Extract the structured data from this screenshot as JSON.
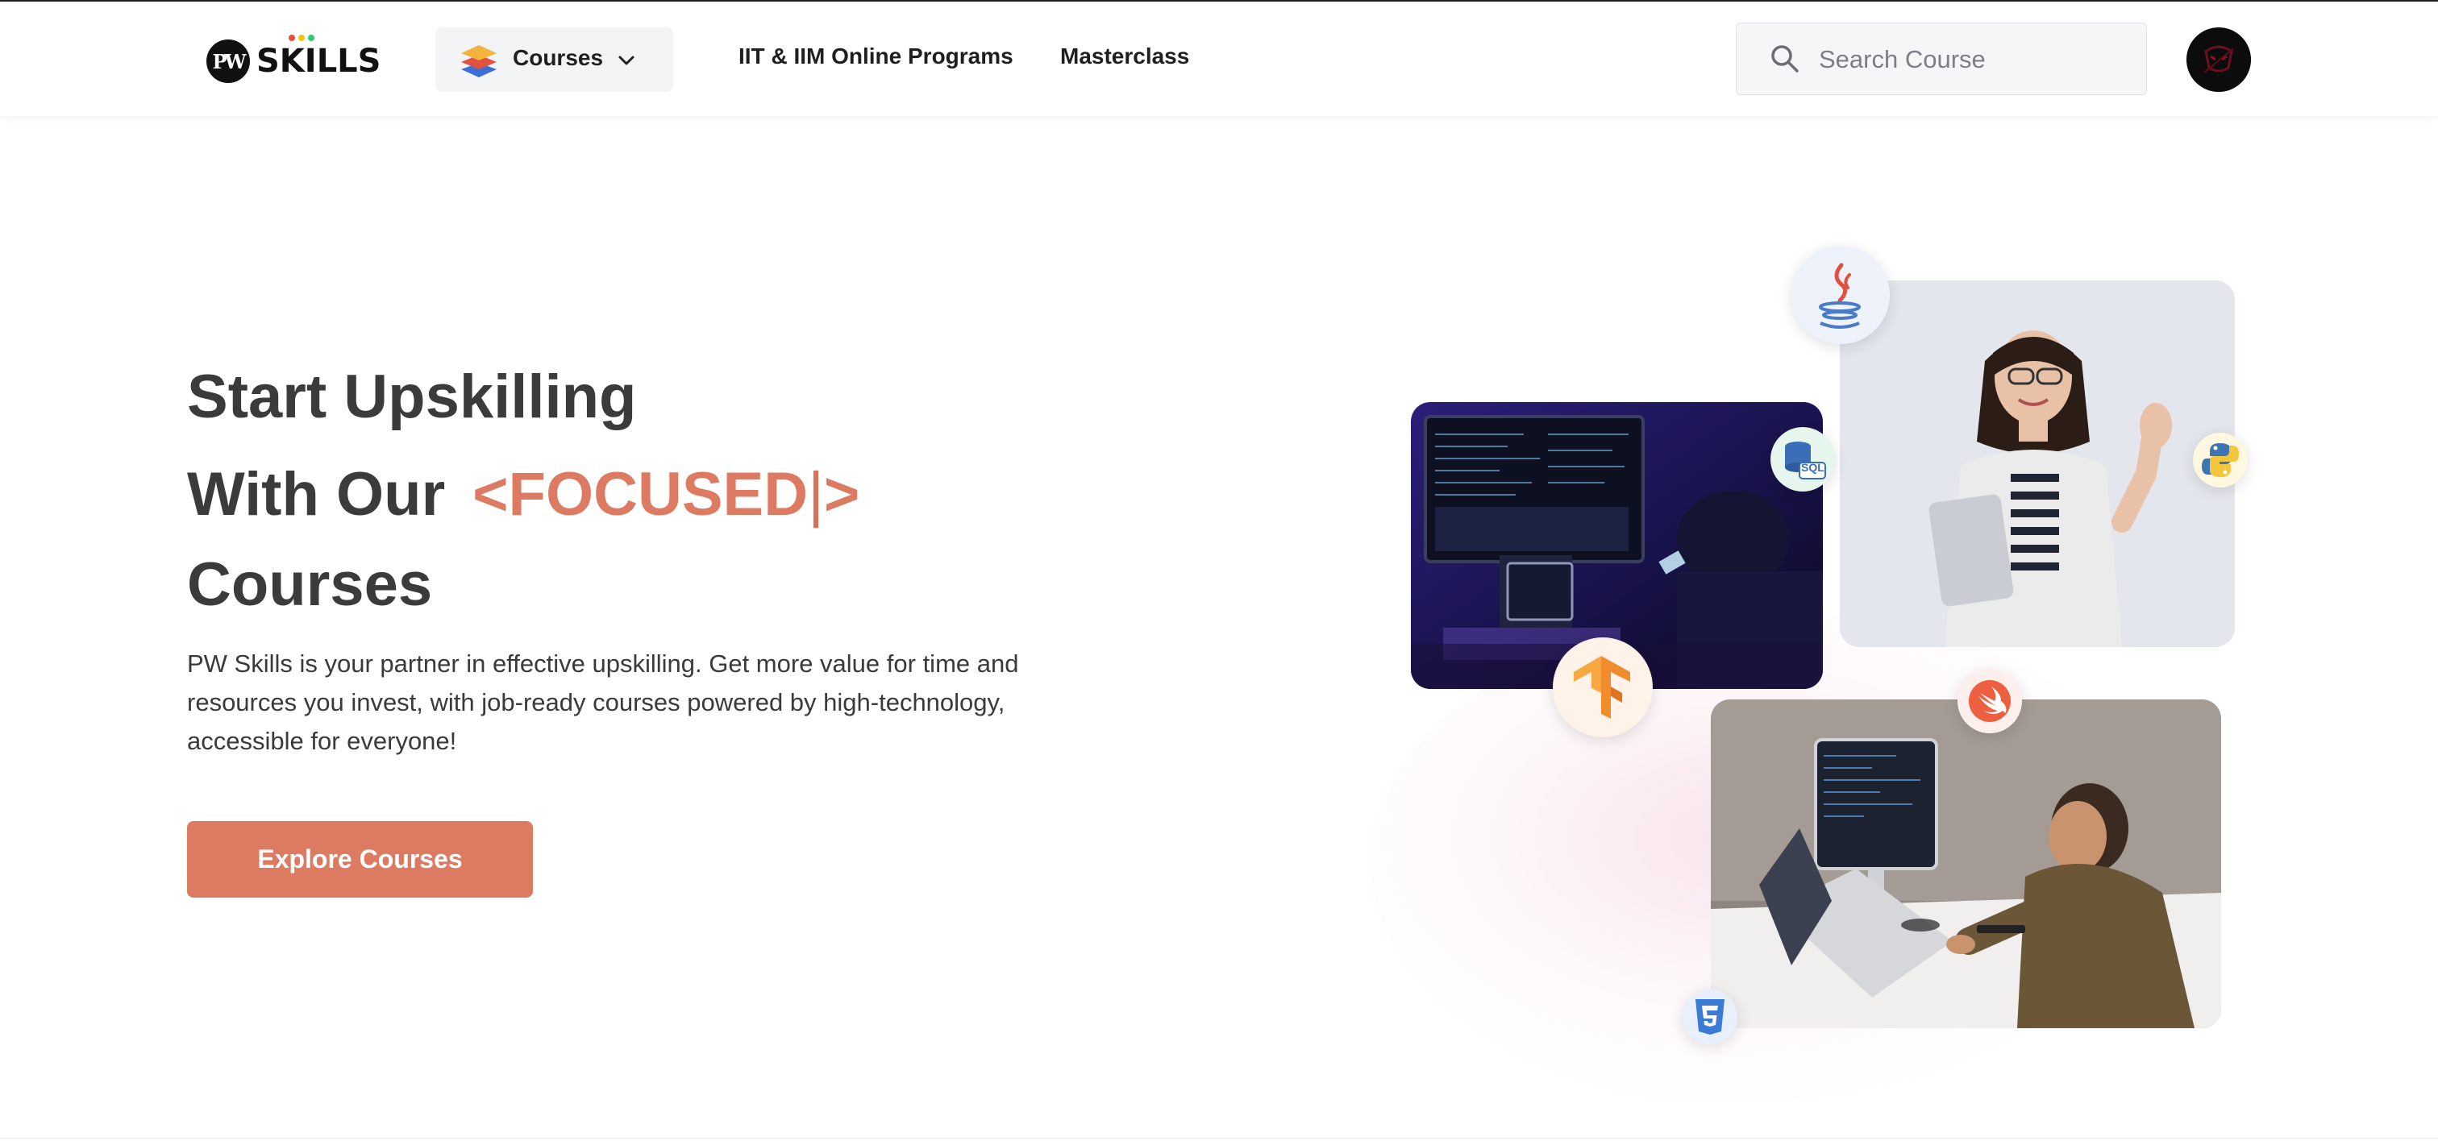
{
  "nav": {
    "logo_text": "SKILLS",
    "logo_mark": "PW",
    "courses_label": "Courses",
    "links": [
      "IIT & IIM Online Programs",
      "Masterclass"
    ],
    "search_placeholder": "Search Course"
  },
  "hero": {
    "title_line1": "Start Upskilling",
    "title_line2": "With Our",
    "typed_word": "<FOCUSED",
    "typed_cursor": "|",
    "typed_close": ">",
    "title_line3": "Courses",
    "description": "PW Skills is your partner in effective upskilling. Get more value for time and resources you invest, with job-ready courses powered by high-technology, accessible for everyone!",
    "cta_label": "Explore Courses"
  },
  "badges": {
    "sql": "SQL"
  },
  "colors": {
    "accent": "#dc7a62",
    "heading": "#3b3b3b",
    "nav_chip_bg": "#f3f4f6"
  },
  "icons": [
    "stack-layers-icon",
    "chevron-down-icon",
    "search-icon",
    "avatar",
    "java-icon",
    "sql-icon",
    "python-icon",
    "tensorflow-icon",
    "swift-icon",
    "css3-icon"
  ]
}
